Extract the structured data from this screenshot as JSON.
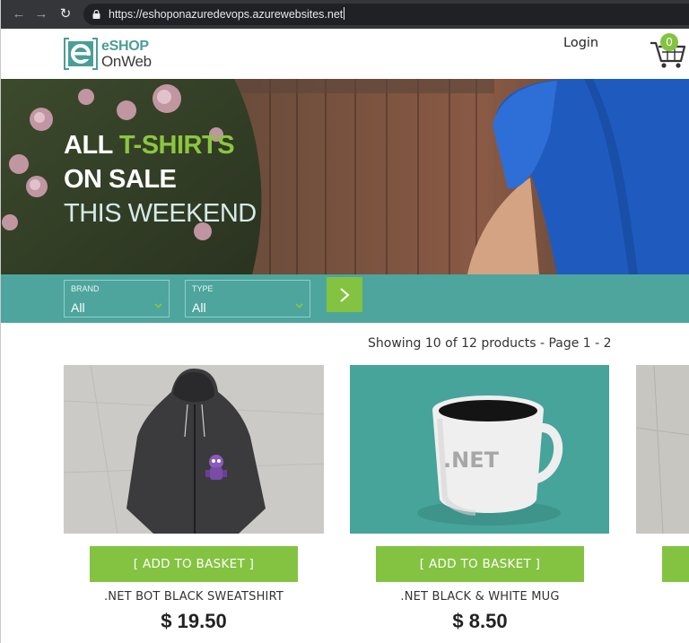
{
  "browser": {
    "url": "https://eshoponazuredevops.azurewebsites.net"
  },
  "header": {
    "logo": {
      "line1": "eSHOP",
      "line2": "OnWeb"
    },
    "login_label": "Login",
    "cart_count": "0"
  },
  "hero": {
    "line1_white": "ALL",
    "line1_accent": "T-SHIRTS",
    "line2": "ON SALE",
    "line3": "THIS WEEKEND"
  },
  "filters": {
    "brand": {
      "label": "BRAND",
      "value": "All"
    },
    "type": {
      "label": "TYPE",
      "value": "All"
    }
  },
  "catalog": {
    "summary": "Showing 10 of 12 products - Page 1 - 2",
    "add_label": "[ ADD TO BASKET ]",
    "products": [
      {
        "name": ".NET BOT BLACK SWEATSHIRT",
        "price": "$ 19.50",
        "image_text": ""
      },
      {
        "name": ".NET BLACK & WHITE MUG",
        "price": "$ 8.50",
        "image_text": ".NET"
      }
    ]
  },
  "colors": {
    "brand_teal": "#4ea59d",
    "accent_green": "#83c341",
    "chrome_dark": "#35363a"
  }
}
